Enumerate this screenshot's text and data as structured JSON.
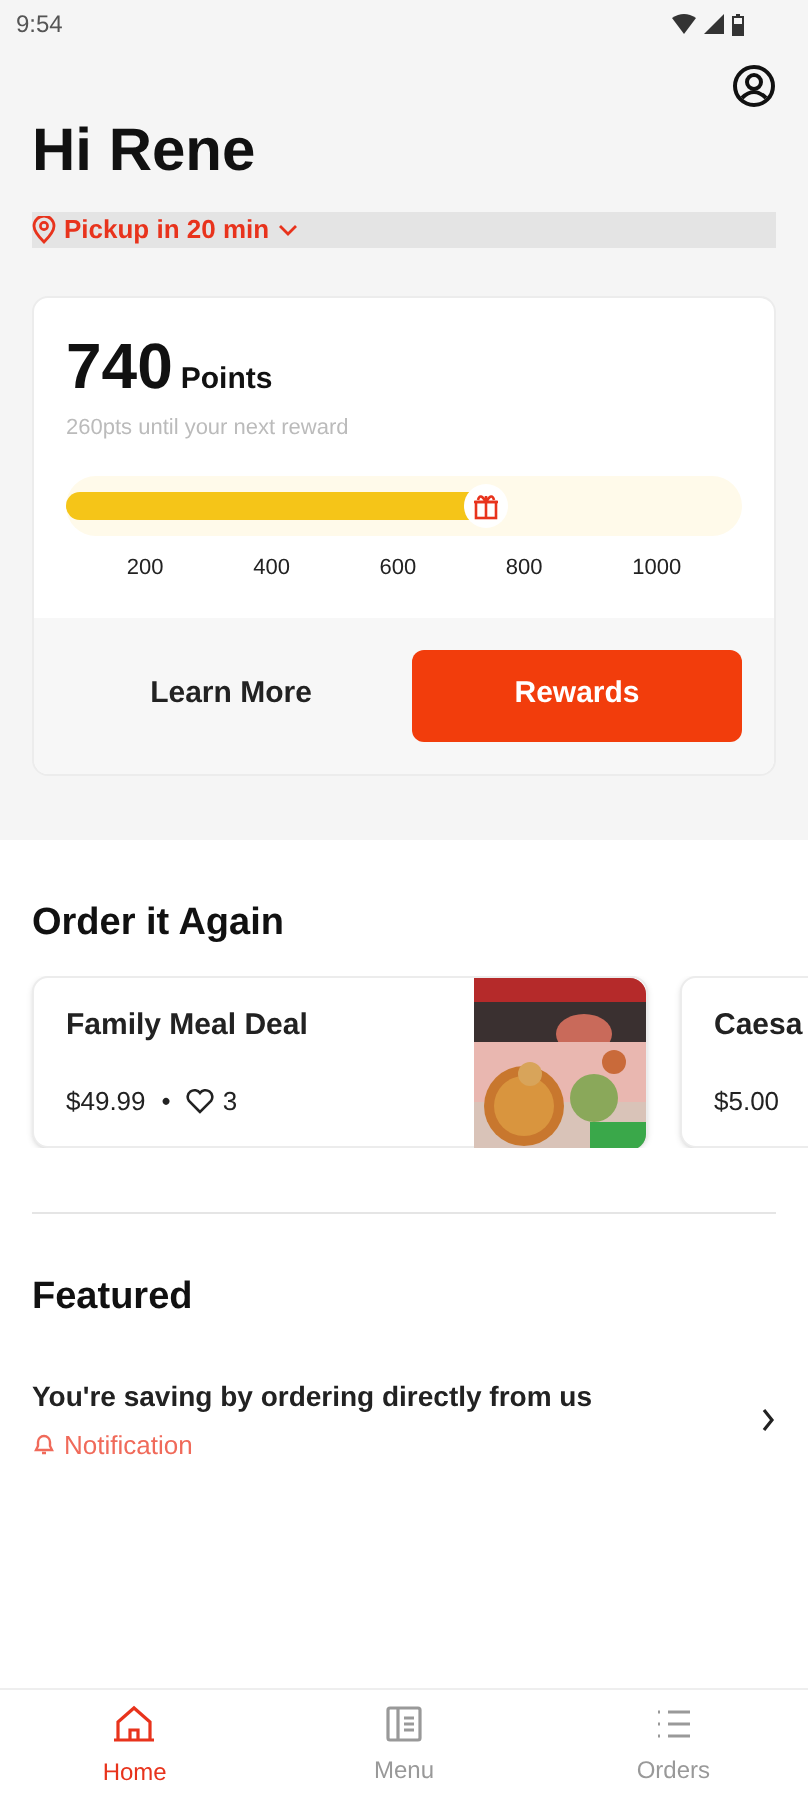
{
  "status_bar": {
    "time": "9:54"
  },
  "greeting": "Hi Rene",
  "pickup": "Pickup in 20 min",
  "rewards": {
    "points": "740",
    "points_label": "Points",
    "subtitle": "260pts until your next reward",
    "level": 0.62,
    "ticks": [
      "200",
      "400",
      "600",
      "800",
      "1000"
    ],
    "learn_more": "Learn More",
    "button": "Rewards"
  },
  "order_again": {
    "title": "Order it Again",
    "items": [
      {
        "name": "Family Meal Deal",
        "price": "$49.99",
        "separator": "•",
        "likes": "3",
        "kind": "picture"
      },
      {
        "name": "Caesa",
        "price": "$5.00"
      }
    ]
  },
  "featured": {
    "title": "Featured",
    "items": [
      {
        "title": "You're saving by ordering directly from us",
        "tag": "Notification"
      }
    ]
  },
  "nav": [
    {
      "label": "Home",
      "selected": true
    },
    {
      "label": "Menu",
      "selected": false
    },
    {
      "label": "Orders",
      "selected": false
    }
  ]
}
